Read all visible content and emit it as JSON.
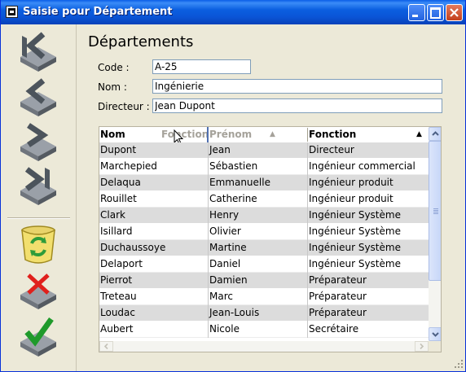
{
  "window": {
    "title": "Saisie pour  Département",
    "accent": "#0a5ee8",
    "close_color": "#d8552f"
  },
  "toolbar": {
    "items": [
      {
        "name": "first-record-button",
        "icon": "first-record-icon"
      },
      {
        "name": "previous-record-button",
        "icon": "previous-record-icon"
      },
      {
        "name": "next-record-button",
        "icon": "next-record-icon"
      },
      {
        "name": "last-record-button",
        "icon": "last-record-icon"
      },
      {
        "name": "recycle-button",
        "icon": "recycle-bin-icon"
      },
      {
        "name": "cancel-button",
        "icon": "cancel-icon"
      },
      {
        "name": "validate-button",
        "icon": "validate-icon"
      }
    ]
  },
  "form": {
    "heading": "Départements",
    "code_label": "Code :",
    "code_value": "A-25",
    "nom_label": "Nom :",
    "nom_value": "Ingénierie",
    "directeur_label": "Directeur :",
    "directeur_value": "Jean Dupont"
  },
  "grid": {
    "columns": [
      "Nom",
      "Prénom",
      "Fonction"
    ],
    "dragging_column": "Fonction",
    "sorted_column": "Fonction",
    "sort_direction": "ascending",
    "rows": [
      [
        "Dupont",
        "Jean",
        "Directeur"
      ],
      [
        "Marchepied",
        "Sébastien",
        "Ingénieur commercial"
      ],
      [
        "Delaqua",
        "Emmanuelle",
        "Ingénieur produit"
      ],
      [
        "Rouillet",
        "Catherine",
        "Ingénieur produit"
      ],
      [
        "Clark",
        "Henry",
        "Ingénieur Système"
      ],
      [
        "Isillard",
        "Olivier",
        "Ingénieur Système"
      ],
      [
        "Duchaussoye",
        "Martine",
        "Ingénieur Système"
      ],
      [
        "Delaport",
        "Daniel",
        "Ingénieur Système"
      ],
      [
        "Pierrot",
        "Damien",
        "Préparateur"
      ],
      [
        "Treteau",
        "Marc",
        "Préparateur"
      ],
      [
        "Loudac",
        "Jean-Louis",
        "Préparateur"
      ],
      [
        "Aubert",
        "Nicole",
        "Secrétaire"
      ]
    ]
  }
}
